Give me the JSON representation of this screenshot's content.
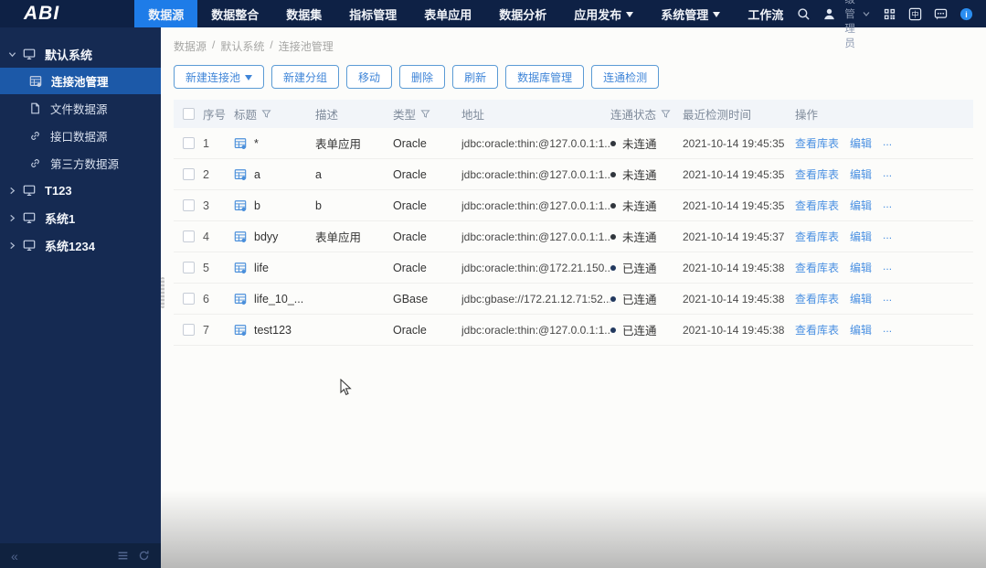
{
  "colors": {
    "topbar_bg": "#0e2145",
    "active_tab_bg": "#1e7ce8",
    "sidebar_bg": "#152a52",
    "sidebar_selected_bg": "#1c59a8",
    "link_blue": "#4a90e2",
    "button_border_blue": "#5b9bd5",
    "disconnected_dot": "#30363d",
    "connected_dot": "#22395f"
  },
  "topbar": {
    "logo": "ABI",
    "tabs": [
      {
        "key": "datasource",
        "label": "数据源",
        "active": true,
        "caret": false
      },
      {
        "key": "data-integration",
        "label": "数据整合",
        "active": false,
        "caret": false
      },
      {
        "key": "dataset",
        "label": "数据集",
        "active": false,
        "caret": false
      },
      {
        "key": "indicator-management",
        "label": "指标管理",
        "active": false,
        "caret": false
      },
      {
        "key": "form-application",
        "label": "表单应用",
        "active": false,
        "caret": false
      },
      {
        "key": "data-analysis",
        "label": "数据分析",
        "active": false,
        "caret": false
      },
      {
        "key": "app-publish",
        "label": "应用发布",
        "active": false,
        "caret": true
      },
      {
        "key": "system-management",
        "label": "系统管理",
        "active": false,
        "caret": true
      },
      {
        "key": "workflow",
        "label": "工作流",
        "active": false,
        "caret": false
      }
    ],
    "user": {
      "name": "超级管理员"
    }
  },
  "sidebar": {
    "items": [
      {
        "key": "default-system",
        "label": "默认系统",
        "level": 0,
        "caret": "down",
        "icon": "monitor-icon",
        "selected": false
      },
      {
        "key": "connection-pool-management",
        "label": "连接池管理",
        "level": 1,
        "caret": "",
        "icon": "connection-pool-icon",
        "selected": true
      },
      {
        "key": "file-datasource",
        "label": "文件数据源",
        "level": 1,
        "caret": "",
        "icon": "file-icon",
        "selected": false
      },
      {
        "key": "api-datasource",
        "label": "接口数据源",
        "level": 1,
        "caret": "",
        "icon": "link-icon",
        "selected": false
      },
      {
        "key": "third-party-datasource",
        "label": "第三方数据源",
        "level": 1,
        "caret": "",
        "icon": "link-icon",
        "selected": false
      },
      {
        "key": "t123",
        "label": "T123",
        "level": 0,
        "caret": "right",
        "icon": "monitor-icon",
        "selected": false
      },
      {
        "key": "system1",
        "label": "系统1",
        "level": 0,
        "caret": "right",
        "icon": "monitor-icon",
        "selected": false
      },
      {
        "key": "system1234",
        "label": "系统1234",
        "level": 0,
        "caret": "right",
        "icon": "monitor-icon",
        "selected": false
      }
    ]
  },
  "main": {
    "breadcrumb": [
      "数据源",
      "默认系统",
      "连接池管理"
    ],
    "toolbar": [
      {
        "key": "new-connection-pool",
        "label": "新建连接池",
        "caret": true
      },
      {
        "key": "new-group",
        "label": "新建分组",
        "caret": false
      },
      {
        "key": "move",
        "label": "移动",
        "caret": false
      },
      {
        "key": "delete",
        "label": "删除",
        "caret": false
      },
      {
        "key": "refresh",
        "label": "刷新",
        "caret": false
      },
      {
        "key": "database-management",
        "label": "数据库管理",
        "caret": false
      },
      {
        "key": "connectivity-check",
        "label": "连通检测",
        "caret": false
      }
    ],
    "table": {
      "headers": [
        {
          "key": "select",
          "label": "",
          "checkbox": true,
          "filter": false
        },
        {
          "key": "no",
          "label": "序号",
          "checkbox": false,
          "filter": false
        },
        {
          "key": "title",
          "label": "标题",
          "checkbox": false,
          "filter": true
        },
        {
          "key": "desc",
          "label": "描述",
          "checkbox": false,
          "filter": false
        },
        {
          "key": "type",
          "label": "类型",
          "checkbox": false,
          "filter": true
        },
        {
          "key": "address",
          "label": "地址",
          "checkbox": false,
          "filter": false
        },
        {
          "key": "status",
          "label": "连通状态",
          "checkbox": false,
          "filter": true
        },
        {
          "key": "time",
          "label": "最近检测时间",
          "checkbox": false,
          "filter": false
        },
        {
          "key": "actions",
          "label": "操作",
          "checkbox": false,
          "filter": false
        }
      ],
      "action_labels": [
        {
          "key": "view-tables",
          "label": "查看库表"
        },
        {
          "key": "edit",
          "label": "编辑"
        },
        {
          "key": "more",
          "label": "..."
        }
      ],
      "rows": [
        {
          "no": "1",
          "title": "*",
          "desc": "表单应用",
          "type": "Oracle",
          "address": "jdbc:oracle:thin:@127.0.0.1:1...",
          "status": "未连通",
          "status_key": "disconnected",
          "time": "2021-10-14 19:45:35"
        },
        {
          "no": "2",
          "title": "a",
          "desc": "a",
          "type": "Oracle",
          "address": "jdbc:oracle:thin:@127.0.0.1:1...",
          "status": "未连通",
          "status_key": "disconnected",
          "time": "2021-10-14 19:45:35"
        },
        {
          "no": "3",
          "title": "b",
          "desc": "b",
          "type": "Oracle",
          "address": "jdbc:oracle:thin:@127.0.0.1:1...",
          "status": "未连通",
          "status_key": "disconnected",
          "time": "2021-10-14 19:45:35"
        },
        {
          "no": "4",
          "title": "bdyy",
          "desc": "表单应用",
          "type": "Oracle",
          "address": "jdbc:oracle:thin:@127.0.0.1:1...",
          "status": "未连通",
          "status_key": "disconnected",
          "time": "2021-10-14 19:45:37"
        },
        {
          "no": "5",
          "title": "life",
          "desc": "",
          "type": "Oracle",
          "address": "jdbc:oracle:thin:@172.21.150....",
          "status": "已连通",
          "status_key": "connected",
          "time": "2021-10-14 19:45:38"
        },
        {
          "no": "6",
          "title": "life_10_...",
          "desc": "",
          "type": "GBase",
          "address": "jdbc:gbase://172.21.12.71:52...",
          "status": "已连通",
          "status_key": "connected",
          "time": "2021-10-14 19:45:38"
        },
        {
          "no": "7",
          "title": "test123",
          "desc": "",
          "type": "Oracle",
          "address": "jdbc:oracle:thin:@127.0.0.1:1...",
          "status": "已连通",
          "status_key": "connected",
          "time": "2021-10-14 19:45:38"
        }
      ]
    }
  },
  "sidebar_footer": {
    "icons": [
      "collapse-icon",
      "list-icon",
      "refresh-icon"
    ]
  }
}
